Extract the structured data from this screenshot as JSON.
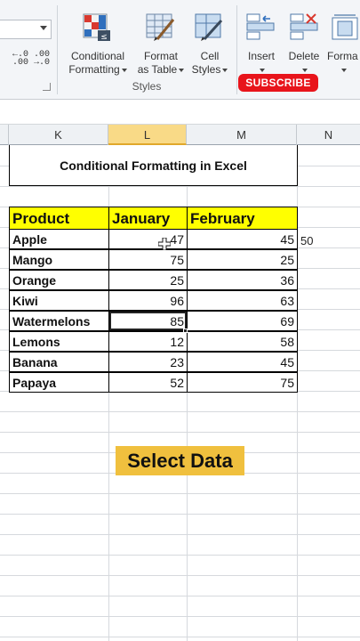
{
  "ribbon": {
    "decimal_increase": [
      "←.0",
      ".00"
    ],
    "decimal_decrease": [
      ".00",
      "→.0"
    ],
    "conditional_formatting": [
      "Conditional",
      "Formatting"
    ],
    "format_as_table": [
      "Format",
      "as Table"
    ],
    "cell_styles": [
      "Cell",
      "Styles"
    ],
    "insert": "Insert",
    "delete": "Delete",
    "format": "Forma",
    "styles_group_label": "Styles",
    "subscribe_label": "SUBSCRIBE"
  },
  "columns": [
    "K",
    "L",
    "M",
    "N"
  ],
  "sheet": {
    "title": "Conditional Formatting in Excel",
    "headers": [
      "Product",
      "January",
      "February"
    ],
    "rows": [
      {
        "product": "Apple",
        "january": "47",
        "february": "45"
      },
      {
        "product": "Mango",
        "january": "75",
        "february": "25"
      },
      {
        "product": "Orange",
        "january": "25",
        "february": "36"
      },
      {
        "product": "Kiwi",
        "january": "96",
        "february": "63"
      },
      {
        "product": "Watermelons",
        "january": "85",
        "february": "69"
      },
      {
        "product": "Lemons",
        "january": "12",
        "february": "58"
      },
      {
        "product": "Banana",
        "january": "23",
        "february": "45"
      },
      {
        "product": "Papaya",
        "january": "52",
        "february": "75"
      }
    ],
    "stray_value": "50",
    "selected_column": "L",
    "active_cell_row": "Watermelons"
  },
  "caption": "Select Data",
  "colors": {
    "header_fill": "#ffff00",
    "caption_fill": "#f0c03e",
    "subscribe": "#e8141b",
    "selected_column_header": "#f9da87"
  }
}
